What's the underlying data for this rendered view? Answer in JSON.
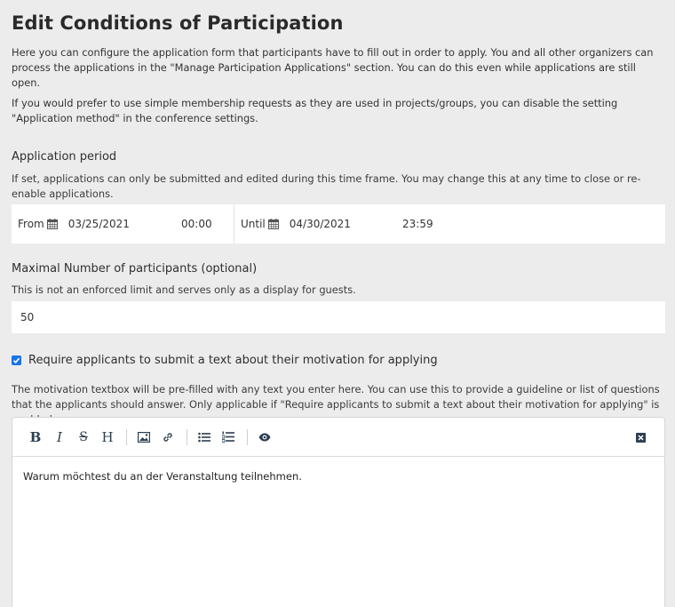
{
  "page": {
    "title": "Edit Conditions of Participation",
    "intro_p1": "Here you can configure the application form that participants have to fill out in order to apply. You and all other organizers can process the applications in the \"Manage Participation Applications\" section. You can do this even while applications are still open.",
    "intro_p2": "If you would prefer to use simple membership requests as they are used in projects/groups, you can disable the setting \"Application method\" in the conference settings."
  },
  "period": {
    "label": "Application period",
    "help": "If set, applications can only be submitted and edited during this time frame. You may change this at any time to close or re-enable applications.",
    "from_label": "From",
    "from_date": "03/25/2021",
    "from_time": "00:00",
    "until_label": "Until",
    "until_date": "04/30/2021",
    "until_time": "23:59",
    "calendar_icon": "calendar-icon"
  },
  "participants": {
    "label": "Maximal Number of participants (optional)",
    "help": "This is not an enforced limit and serves only as a display for guests.",
    "value": "50"
  },
  "motivation": {
    "checkbox_label": "Require applicants to submit a text about their motivation for applying",
    "checked": true,
    "help": "The motivation textbox will be pre-filled with any text you enter here. You can use this to provide a guideline or list of questions that the applicants should answer. Only applicable if \"Require applicants to submit a text about their motivation for applying\" is enabled.",
    "editor_text": "Warum möchtest du an der Veranstaltung teilnehmen."
  },
  "toolbar": {
    "bold": "B",
    "italic": "I",
    "strike": "S",
    "heading": "H",
    "icons": [
      "bold-icon",
      "italic-icon",
      "strikethrough-icon",
      "heading-icon",
      "image-icon",
      "link-icon",
      "bullet-list-icon",
      "numbered-list-icon",
      "preview-eye-icon",
      "fullscreen-close-icon"
    ]
  },
  "colors": {
    "background": "#ececec",
    "checkbox": "#1a73e8",
    "input_bg": "#ffffff"
  }
}
